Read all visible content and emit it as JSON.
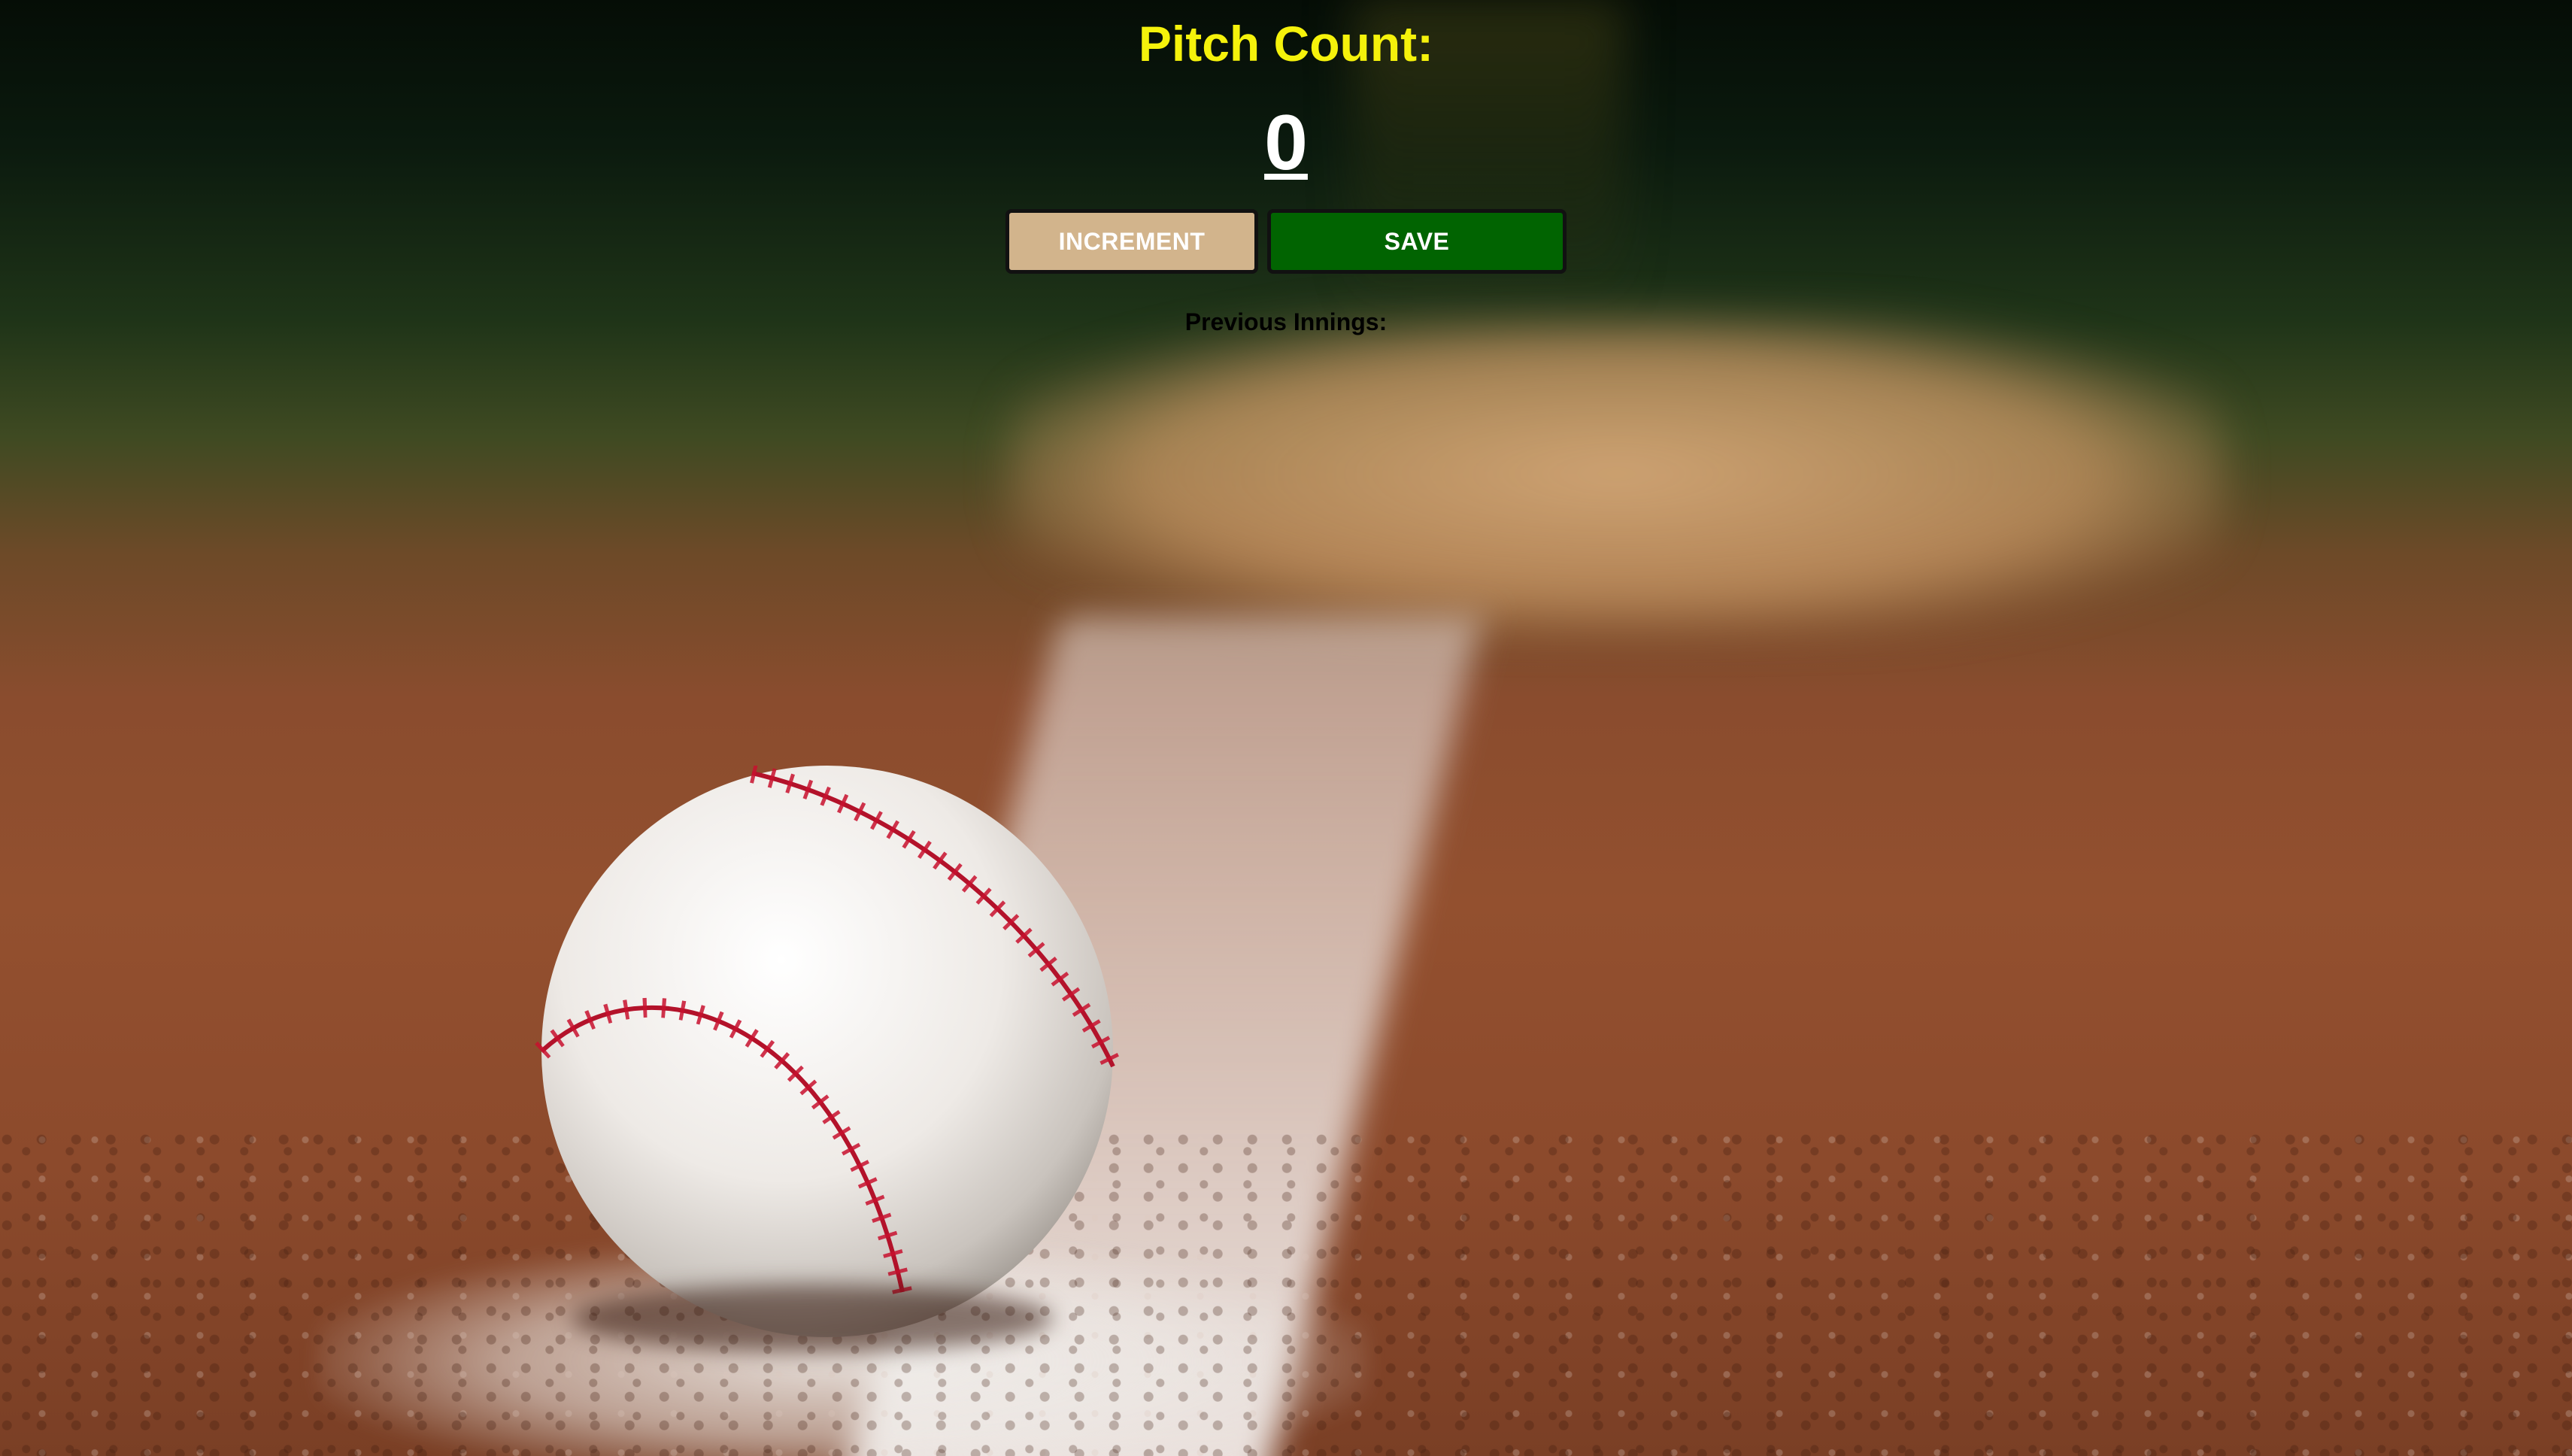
{
  "header": {
    "title": "Pitch Count:"
  },
  "counter": {
    "value": "0"
  },
  "actions": {
    "increment_label": "INCREMENT",
    "save_label": "SAVE"
  },
  "history": {
    "label": "Previous Innings:"
  },
  "colors": {
    "title": "#f5f20b",
    "increment_button": "#d2b48c",
    "save_button": "#016401"
  },
  "background": {
    "image": "baseball-on-infield-chalk-line"
  }
}
